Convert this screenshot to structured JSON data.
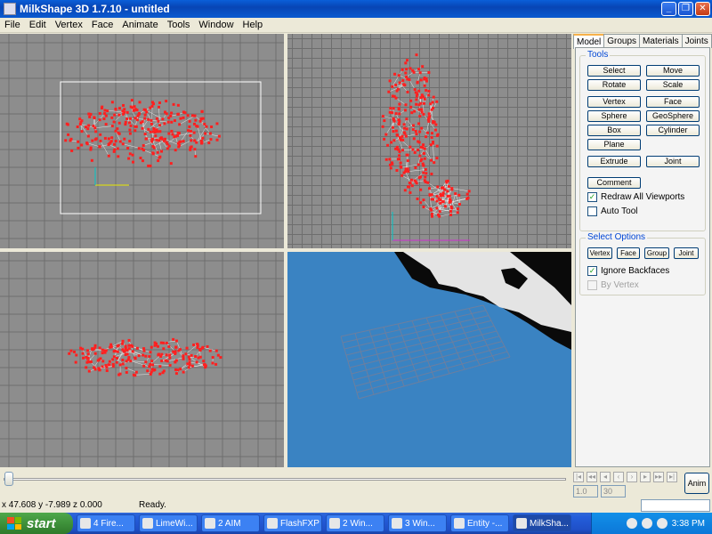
{
  "window": {
    "title": "MilkShape 3D 1.7.10 - untitled"
  },
  "menu": [
    "File",
    "Edit",
    "Vertex",
    "Face",
    "Animate",
    "Tools",
    "Window",
    "Help"
  ],
  "tabs": [
    "Model",
    "Groups",
    "Materials",
    "Joints"
  ],
  "tools": {
    "group_label": "Tools",
    "buttons": [
      "Select",
      "Move",
      "Rotate",
      "Scale",
      "Vertex",
      "Face",
      "Sphere",
      "GeoSphere",
      "Box",
      "Cylinder",
      "Plane",
      "Extrude",
      "Joint",
      "Comment"
    ],
    "redraw_label": "Redraw All Viewports",
    "autotool_label": "Auto Tool"
  },
  "select_options": {
    "group_label": "Select Options",
    "buttons": [
      "Vertex",
      "Face",
      "Group",
      "Joint"
    ],
    "ignore_backfaces_label": "Ignore Backfaces",
    "by_vertex_label": "By Vertex"
  },
  "timeline": {
    "start_frame": "1.0",
    "end_frame": "30",
    "anim_label": "Anim"
  },
  "status": {
    "coords": "x 47.608 y -7.989 z 0.000",
    "text": "Ready."
  },
  "taskbar": {
    "start_label": "start",
    "tasks": [
      "4 Fire...",
      "LimeWi...",
      "2 AIM",
      "FlashFXP",
      "2 Win...",
      "3 Win...",
      "Entity -...",
      "MilkSha..."
    ],
    "clock": "3:38 PM"
  },
  "colors": {
    "vertex": "#ff2020",
    "wire": "#ffffff",
    "viewport_bg": "#8d8d8d",
    "viewport_3d_bg": "#3a83c2",
    "grid": "#6e6e6e"
  }
}
